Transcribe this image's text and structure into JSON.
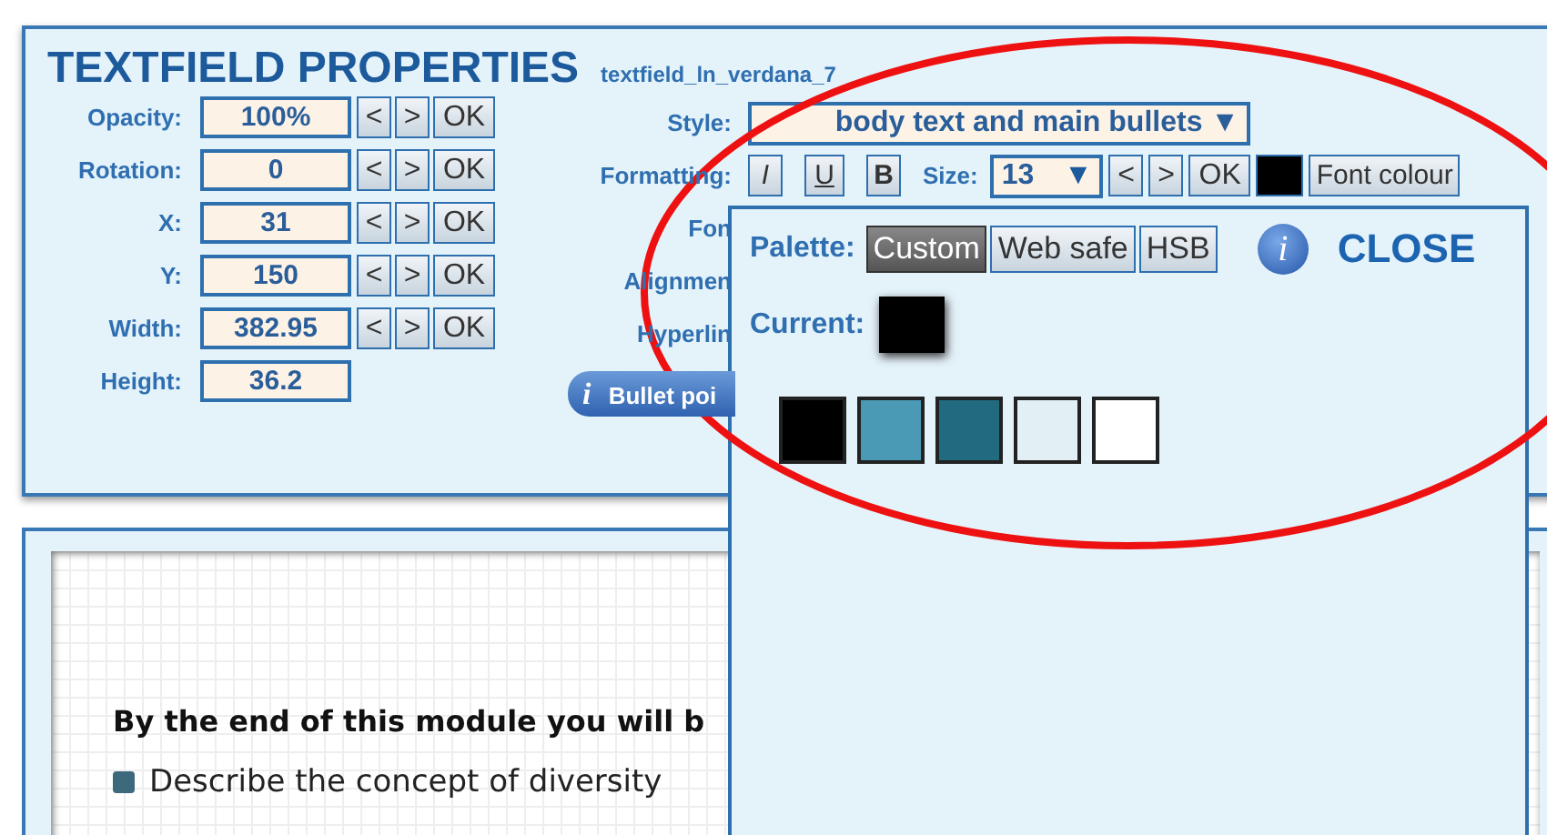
{
  "panel": {
    "title": "TEXTFIELD PROPERTIES",
    "subtitle": "textfield_ln_verdana_7",
    "fields": [
      {
        "label": "Opacity:",
        "value": "100%",
        "buttons": [
          "<",
          ">",
          "OK"
        ]
      },
      {
        "label": "Rotation:",
        "value": "0",
        "buttons": [
          "<",
          ">",
          "OK"
        ]
      },
      {
        "label": "X:",
        "value": "31",
        "buttons": [
          "<",
          ">",
          "OK"
        ]
      },
      {
        "label": "Y:",
        "value": "150",
        "buttons": [
          "<",
          ">",
          "OK"
        ]
      },
      {
        "label": "Width:",
        "value": "382.95",
        "buttons": [
          "<",
          ">",
          "OK"
        ]
      },
      {
        "label": "Height:",
        "value": "36.2"
      }
    ],
    "style": {
      "label": "Style:",
      "value": "body text and main bullets",
      "arrow": "▼"
    },
    "formatting": {
      "label": "Formatting:",
      "buttons": [
        "I",
        "U",
        "B"
      ],
      "size_label": "Size:",
      "size": "13",
      "arrow": "▼",
      "size_buttons": [
        "<",
        ">",
        "OK"
      ],
      "colour_button": "Font colour"
    },
    "hidden_labels": [
      "Fon",
      "Alignmen",
      "Hyperlin"
    ],
    "info_button": {
      "icon": "i",
      "label": "Bullet poi"
    }
  },
  "color_popup": {
    "palette_label": "Palette:",
    "tabs": [
      {
        "label": "Custom",
        "selected": true
      },
      {
        "label": "Web safe",
        "selected": false
      },
      {
        "label": "HSB",
        "selected": false
      }
    ],
    "info": "i",
    "close": "CLOSE",
    "current_label": "Current:",
    "swatches": [
      {
        "color": "#000000"
      },
      {
        "color": "#4a9ab5"
      },
      {
        "color": "#226a80"
      },
      {
        "color": "#e2f0f5"
      },
      {
        "color": "#ffffff"
      }
    ]
  },
  "page": {
    "heading": "By the end of this module you will b",
    "bullets": [
      "Describe the concept of diversity"
    ]
  }
}
